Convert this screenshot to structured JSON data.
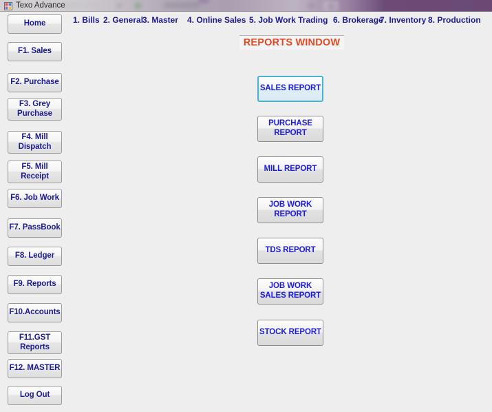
{
  "window": {
    "title": "Texo Advance",
    "icon": "app-window-icon"
  },
  "menubar": {
    "items": [
      {
        "label": "1. Bills"
      },
      {
        "label": "2. General"
      },
      {
        "label": "3. Master"
      },
      {
        "label": "4. Online Sales"
      },
      {
        "label": "5. Job Work Trading"
      },
      {
        "label": "6. Brokerage"
      },
      {
        "label": "7. Inventory"
      },
      {
        "label": "8. Production"
      }
    ]
  },
  "sidebar": {
    "items": [
      {
        "label": "Home",
        "name": "home"
      },
      {
        "label": "F1. Sales",
        "name": "f1-sales"
      },
      {
        "label": "F2. Purchase",
        "name": "f2-purchase"
      },
      {
        "label": "F3. Grey\nPurchase",
        "name": "f3-grey-purchase"
      },
      {
        "label": "F4. Mill\nDispatch",
        "name": "f4-mill-dispatch"
      },
      {
        "label": "F5. Mill\nReceipt",
        "name": "f5-mill-receipt"
      },
      {
        "label": "F6. Job Work",
        "name": "f6-job-work"
      },
      {
        "label": "F7. PassBook",
        "name": "f7-passbook"
      },
      {
        "label": "F8. Ledger",
        "name": "f8-ledger"
      },
      {
        "label": "F9. Reports",
        "name": "f9-reports"
      },
      {
        "label": "F10.Accounts",
        "name": "f10-accounts"
      },
      {
        "label": "F11.GST\nReports",
        "name": "f11-gst-reports"
      },
      {
        "label": "F12. MASTER",
        "name": "f12-master"
      },
      {
        "label": "Log Out",
        "name": "log-out"
      }
    ]
  },
  "main": {
    "title": "REPORTS WINDOW",
    "report_buttons": [
      {
        "label": "SALES REPORT",
        "name": "sales-report",
        "focused": true
      },
      {
        "label": "PURCHASE\nREPORT",
        "name": "purchase-report",
        "focused": false
      },
      {
        "label": "MILL REPORT",
        "name": "mill-report",
        "focused": false
      },
      {
        "label": "JOB WORK\nREPORT",
        "name": "job-work-report",
        "focused": false
      },
      {
        "label": "TDS REPORT",
        "name": "tds-report",
        "focused": false
      },
      {
        "label": "JOB WORK\nSALES REPORT",
        "name": "job-work-sales-report",
        "focused": false
      },
      {
        "label": "STOCK REPORT",
        "name": "stock-report",
        "focused": false
      }
    ]
  },
  "colors": {
    "menu_text": "#1b1b8f",
    "sidebar_text": "#1b1b8f",
    "report_text": "#1a1ae0",
    "title_text": "#e04a23",
    "focus_border": "#4ab3cc",
    "background": "#efeeee",
    "titlebar_right": "#6a4975"
  }
}
